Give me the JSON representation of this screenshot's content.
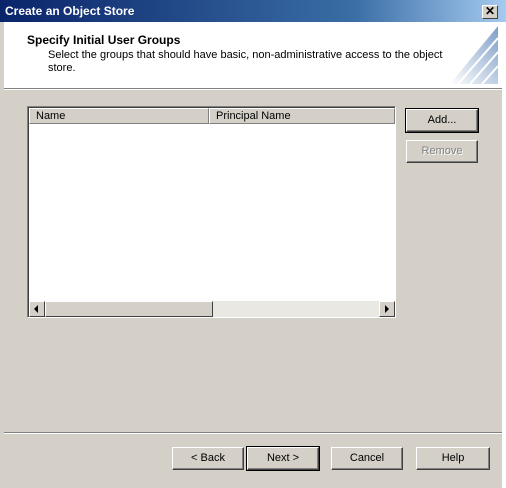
{
  "window": {
    "title": "Create an Object Store",
    "close_glyph": "✕"
  },
  "header": {
    "title": "Specify Initial User Groups",
    "description": "Select the groups that should have basic, non-administrative access to the object store."
  },
  "list": {
    "columns": [
      "Name",
      "Principal Name"
    ],
    "rows": []
  },
  "buttons": {
    "add": "Add...",
    "remove": "Remove",
    "back": "< Back",
    "next": "Next >",
    "cancel": "Cancel",
    "help": "Help"
  },
  "colors": {
    "dialog_bg": "#d4d0c8",
    "title_bar": "#0a246a",
    "panel_bg": "#ffffff",
    "disabled_text": "#808080"
  },
  "icons": {
    "close": "close-icon",
    "scroll_left": "scroll-left-arrow-icon",
    "scroll_right": "scroll-right-arrow-icon",
    "header_graphic": "wizard-header-graphic"
  }
}
